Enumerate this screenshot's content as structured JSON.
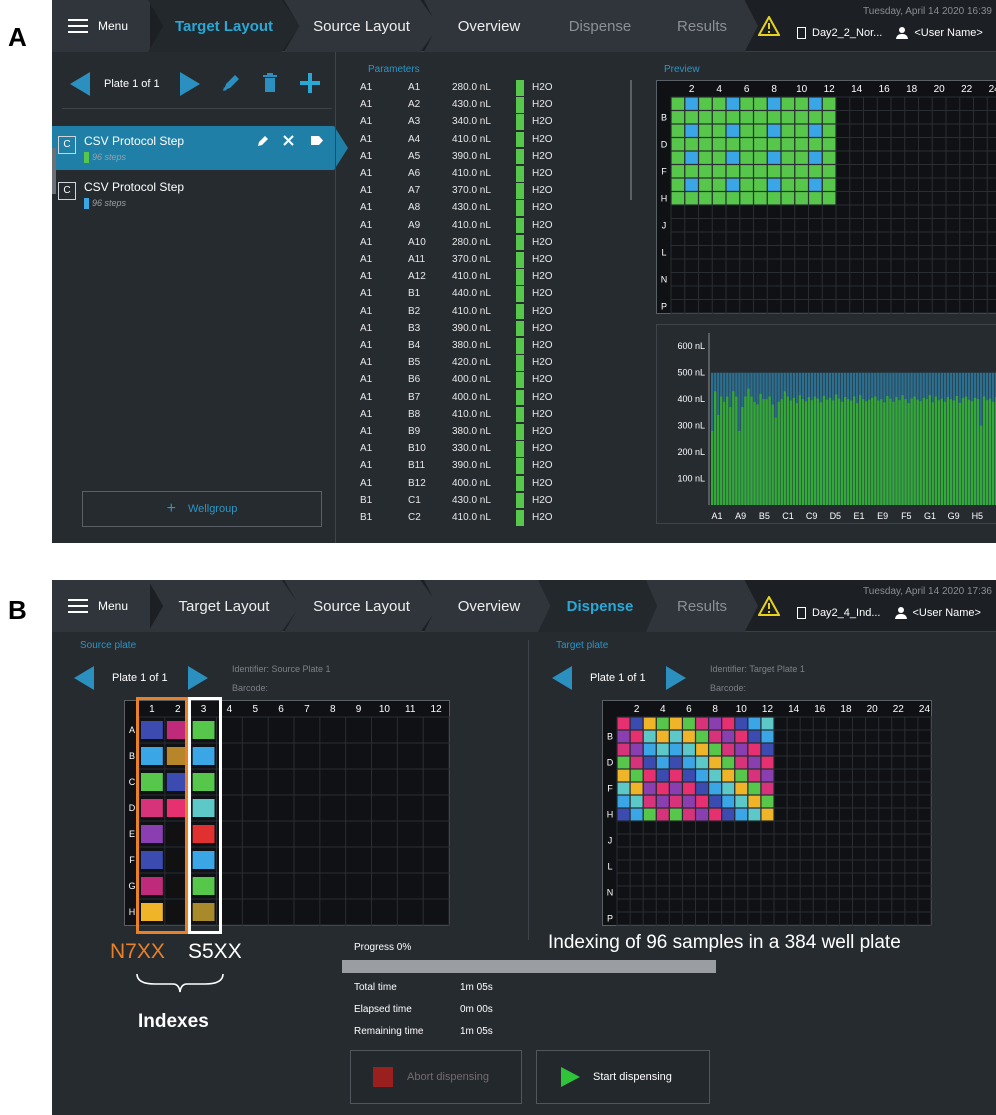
{
  "figure_labels": {
    "a": "A",
    "b": "B"
  },
  "colors": {
    "accent": "#29a8d6",
    "well_green": "#57c74b",
    "well_blue": "#3aa6e6",
    "bar_green": "#35a83a",
    "bar_blue_top": "#2d6f8f",
    "orange_box": "#e9802a",
    "overlay_text_orange": "#e9802a"
  },
  "panelA": {
    "menu_label": "Menu",
    "tabs": [
      {
        "label": "Target Layout",
        "state": "active"
      },
      {
        "label": "Source Layout",
        "state": "normal"
      },
      {
        "label": "Overview",
        "state": "normal"
      },
      {
        "label": "Dispense",
        "state": "dim"
      },
      {
        "label": "Results",
        "state": "dim"
      }
    ],
    "datetime": "Tuesday, April 14 2020 16:39",
    "filename": "Day2_2_Nor...",
    "user": "<User Name>",
    "plate_label": "Plate 1 of 1",
    "steps": [
      {
        "title": "CSV Protocol Step",
        "sub": "96 steps",
        "color": "#57c74b",
        "selected": true
      },
      {
        "title": "CSV Protocol Step",
        "sub": "96 steps",
        "color": "#3aa6e6",
        "selected": false
      }
    ],
    "add_wellgroup_label": "Wellgroup",
    "parameters_title": "Parameters",
    "parameters": [
      [
        "A1",
        "A1",
        "280.0 nL",
        "H2O"
      ],
      [
        "A1",
        "A2",
        "430.0 nL",
        "H2O"
      ],
      [
        "A1",
        "A3",
        "340.0 nL",
        "H2O"
      ],
      [
        "A1",
        "A4",
        "410.0 nL",
        "H2O"
      ],
      [
        "A1",
        "A5",
        "390.0 nL",
        "H2O"
      ],
      [
        "A1",
        "A6",
        "410.0 nL",
        "H2O"
      ],
      [
        "A1",
        "A7",
        "370.0 nL",
        "H2O"
      ],
      [
        "A1",
        "A8",
        "430.0 nL",
        "H2O"
      ],
      [
        "A1",
        "A9",
        "410.0 nL",
        "H2O"
      ],
      [
        "A1",
        "A10",
        "280.0 nL",
        "H2O"
      ],
      [
        "A1",
        "A11",
        "370.0 nL",
        "H2O"
      ],
      [
        "A1",
        "A12",
        "410.0 nL",
        "H2O"
      ],
      [
        "A1",
        "B1",
        "440.0 nL",
        "H2O"
      ],
      [
        "A1",
        "B2",
        "410.0 nL",
        "H2O"
      ],
      [
        "A1",
        "B3",
        "390.0 nL",
        "H2O"
      ],
      [
        "A1",
        "B4",
        "380.0 nL",
        "H2O"
      ],
      [
        "A1",
        "B5",
        "420.0 nL",
        "H2O"
      ],
      [
        "A1",
        "B6",
        "400.0 nL",
        "H2O"
      ],
      [
        "A1",
        "B7",
        "400.0 nL",
        "H2O"
      ],
      [
        "A1",
        "B8",
        "410.0 nL",
        "H2O"
      ],
      [
        "A1",
        "B9",
        "380.0 nL",
        "H2O"
      ],
      [
        "A1",
        "B10",
        "330.0 nL",
        "H2O"
      ],
      [
        "A1",
        "B11",
        "390.0 nL",
        "H2O"
      ],
      [
        "A1",
        "B12",
        "400.0 nL",
        "H2O"
      ],
      [
        "B1",
        "C1",
        "430.0 nL",
        "H2O"
      ],
      [
        "B1",
        "C2",
        "410.0 nL",
        "H2O"
      ]
    ],
    "preview_title": "Preview",
    "preview_cols": [
      "2",
      "4",
      "6",
      "8",
      "10",
      "12",
      "14",
      "16",
      "18",
      "20",
      "22",
      "24"
    ],
    "preview_rows": [
      "B",
      "D",
      "F",
      "H",
      "J",
      "L",
      "N",
      "P"
    ],
    "histogram": {
      "ylabels": [
        "600 nL",
        "500 nL",
        "400 nL",
        "300 nL",
        "200 nL",
        "100 nL"
      ],
      "xlabels": [
        "A1",
        "A9",
        "B5",
        "C1",
        "C9",
        "D5",
        "E1",
        "E9",
        "F5",
        "G1",
        "G9",
        "H5"
      ],
      "ymax": 650,
      "target": 500,
      "values": [
        280,
        430,
        340,
        410,
        390,
        410,
        370,
        430,
        410,
        280,
        370,
        410,
        440,
        410,
        390,
        380,
        420,
        400,
        400,
        410,
        380,
        330,
        390,
        400,
        430,
        410,
        395,
        405,
        385,
        415,
        400,
        392,
        408,
        396,
        410,
        402,
        388,
        412,
        398,
        405,
        395,
        418,
        402,
        390,
        408,
        400,
        395,
        410,
        385,
        415,
        400,
        392,
        398,
        405,
        410,
        395,
        400,
        388,
        412,
        402,
        390,
        408,
        396,
        415,
        400,
        385,
        402,
        410,
        398,
        392,
        405,
        400,
        415,
        388,
        410,
        396,
        402,
        390,
        408,
        400,
        395,
        412,
        386,
        404,
        410,
        398,
        392,
        405,
        400,
        300,
        410,
        396,
        402,
        390,
        408,
        400
      ]
    }
  },
  "panelB": {
    "menu_label": "Menu",
    "tabs": [
      {
        "label": "Target Layout",
        "state": "normal"
      },
      {
        "label": "Source Layout",
        "state": "normal"
      },
      {
        "label": "Overview",
        "state": "normal"
      },
      {
        "label": "Dispense",
        "state": "active"
      },
      {
        "label": "Results",
        "state": "dim"
      }
    ],
    "datetime": "Tuesday, April 14 2020 17:36",
    "filename": "Day2_4_Ind...",
    "user": "<User Name>",
    "source": {
      "title": "Source plate",
      "plate_label": "Plate 1 of 1",
      "identifier": "Identifier: Source Plate 1",
      "barcode": "Barcode:",
      "cols": [
        "1",
        "2",
        "3",
        "4",
        "5",
        "6",
        "7",
        "8",
        "9",
        "10",
        "11",
        "12"
      ],
      "rows": [
        "A",
        "B",
        "C",
        "D",
        "E",
        "F",
        "G",
        "H"
      ],
      "col1_colors": [
        "#3b4bb0",
        "#3aa6e6",
        "#57c74b",
        "#d6337a",
        "#8a3fb0",
        "#3b4bb0",
        "#c02a7a",
        "#f0b429"
      ],
      "col2_colors": [
        "#c02a7a",
        "#b8862a",
        "#3b4bb0",
        "#e63070",
        "#111111",
        "#111111",
        "#111111",
        "#111111"
      ],
      "col3_colors": [
        "#57c74b",
        "#3aa6e6",
        "#57c74b",
        "#5cc8c8",
        "#e03030",
        "#3aa6e6",
        "#57c74b",
        "#a88a2a"
      ]
    },
    "target": {
      "title": "Target plate",
      "plate_label": "Plate 1 of 1",
      "identifier": "Identifier: Target Plate 1",
      "barcode": "Barcode:",
      "cols": [
        "2",
        "4",
        "6",
        "8",
        "10",
        "12",
        "14",
        "16",
        "18",
        "20",
        "22",
        "24"
      ],
      "rows": [
        "B",
        "D",
        "F",
        "H",
        "J",
        "L",
        "N",
        "P"
      ]
    },
    "progress_label": "Progress 0%",
    "progress": 0,
    "stats": [
      {
        "label": "Total time",
        "value": "1m 05s"
      },
      {
        "label": "Elapsed time",
        "value": "0m 00s"
      },
      {
        "label": "Remaining time",
        "value": "1m 05s"
      }
    ],
    "abort_label": "Abort dispensing",
    "start_label": "Start dispensing",
    "overlay": {
      "n7xx": "N7XX",
      "s5xx": "S5XX",
      "indexes": "Indexes",
      "caption": "Indexing of 96 samples in a 384 well  plate"
    }
  }
}
